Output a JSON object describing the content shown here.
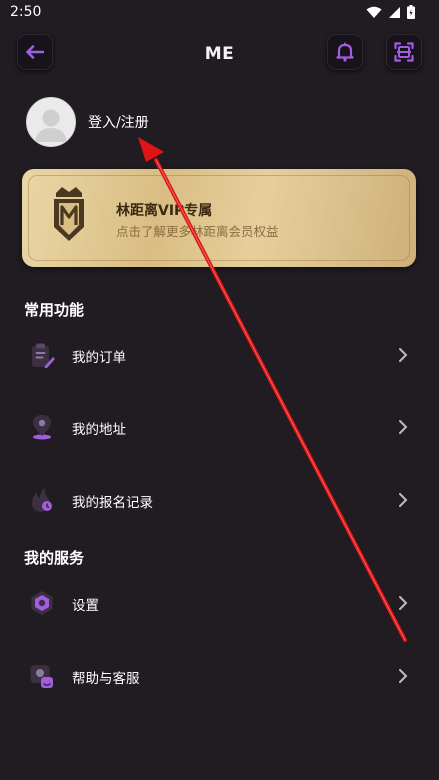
{
  "status_bar": {
    "time": "2:50"
  },
  "header": {
    "title": "ME"
  },
  "profile": {
    "login_text": "登入/注册"
  },
  "vip_card": {
    "title": "林距离VIP专属",
    "subtitle": "点击了解更多林距离会员权益"
  },
  "common_functions": {
    "title": "常用功能",
    "items": [
      {
        "label": "我的订单",
        "icon": "order-clipboard-icon"
      },
      {
        "label": "我的地址",
        "icon": "location-pin-icon"
      },
      {
        "label": "我的报名记录",
        "icon": "flame-record-icon"
      }
    ]
  },
  "my_services": {
    "title": "我的服务",
    "items": [
      {
        "label": "设置",
        "icon": "hexagon-settings-icon"
      },
      {
        "label": "帮助与客服",
        "icon": "help-service-icon"
      }
    ]
  },
  "colors": {
    "accent": "#a25de0",
    "background": "#201c22",
    "vip_gold": "#dcc08a",
    "annotation_arrow": "#e01414"
  }
}
